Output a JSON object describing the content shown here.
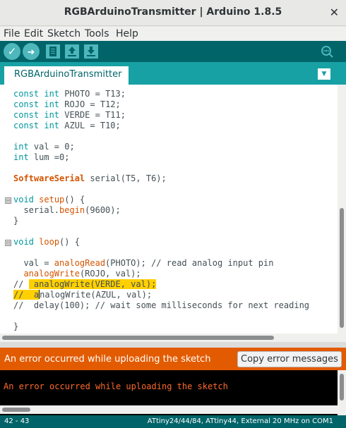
{
  "window": {
    "title": "RGBArduinoTransmitter | Arduino 1.8.5",
    "close_glyph": "✕"
  },
  "menu": {
    "items": [
      "File",
      "Edit",
      "Sketch",
      "Tools",
      "Help"
    ]
  },
  "toolbar": {
    "verify_glyph": "✓",
    "upload_glyph": "➜",
    "buttons": [
      "checkmark-icon",
      "arrow-right-icon",
      "new-file-icon",
      "open-arrow-up-icon",
      "save-arrow-down-icon",
      "serial-monitor-icon"
    ]
  },
  "tab": {
    "label": "RGBArduinoTransmitter",
    "menu_glyph": "▼"
  },
  "editor": {
    "lines": [
      "const int PHOTO = T13;",
      "const int ROJO = T12;",
      "const int VERDE = T11;",
      "const int AZUL = T10;",
      "",
      "int val = 0;",
      "int lum =0;",
      "",
      "SoftwareSerial serial(T5, T6);",
      "",
      "void setup() {",
      "  serial.begin(9600);",
      "}",
      "",
      "void loop() {",
      "",
      "  val = analogRead(PHOTO); // read analog input pin",
      "  analogWrite(ROJO, val);",
      "//  analogWrite(VERDE, val);",
      "//  analogWrite(AZUL, val);",
      "//  delay(100); // wait some milliseconds for next reading",
      "",
      "}"
    ],
    "fold_markers": [
      "⊟",
      "⊟"
    ]
  },
  "error": {
    "message": "An error occurred while uploading the sketch",
    "copy_button": "Copy error messages"
  },
  "console": {
    "output": "An error occurred while uploading the sketch"
  },
  "status": {
    "position": "42 - 43",
    "board": "ATtiny24/44/84, ATtiny44, External 20 MHz on COM1"
  },
  "colors": {
    "toolbar": "#006468",
    "tabbar": "#17a1a5",
    "error_bar": "#e35b00",
    "keyword": "#00979c",
    "function": "#d35400",
    "highlight": "#ffd000"
  }
}
